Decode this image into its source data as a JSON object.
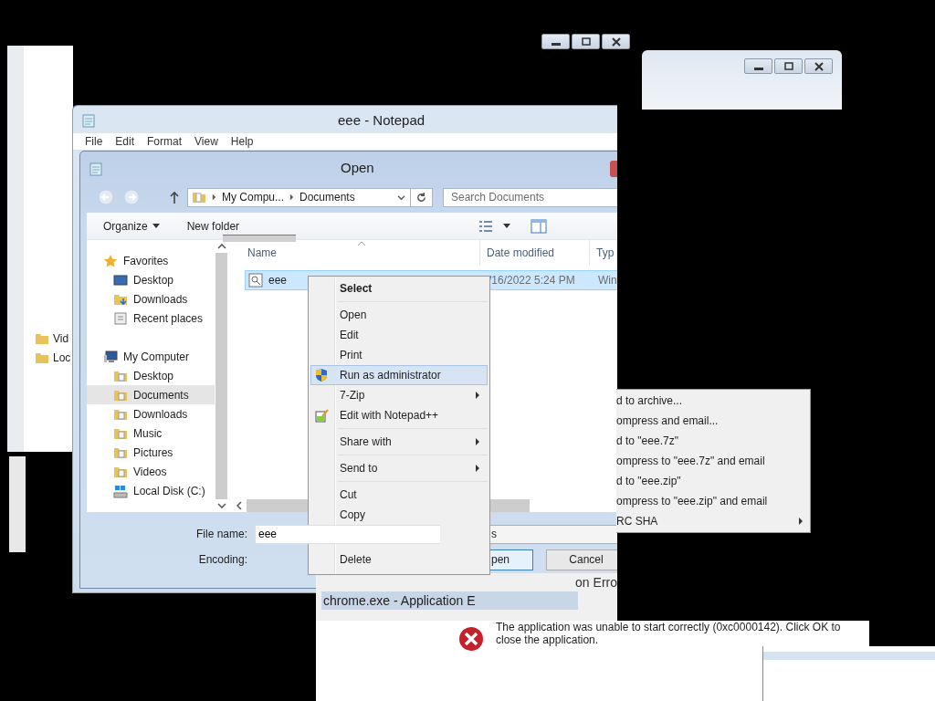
{
  "left_fragment": {
    "items": [
      {
        "label": "Vid"
      },
      {
        "label": "Loc"
      }
    ]
  },
  "notepad": {
    "title": "eee - Notepad",
    "menu": [
      "File",
      "Edit",
      "Format",
      "View",
      "Help"
    ]
  },
  "open_dialog": {
    "title": "Open",
    "breadcrumb": [
      "My Compu...",
      "Documents"
    ],
    "search": {
      "placeholder": "Search Documents"
    },
    "toolbar": {
      "organize": "Organize",
      "new_folder": "New folder"
    },
    "nav": [
      {
        "label": "Favorites",
        "kind": "favorites",
        "selected": false,
        "children": [
          {
            "label": "Desktop",
            "kind": "desktop",
            "selected": false
          },
          {
            "label": "Downloads",
            "kind": "downloads",
            "selected": false
          },
          {
            "label": "Recent places",
            "kind": "recent",
            "selected": false
          }
        ]
      },
      {
        "label": "My Computer",
        "kind": "computer",
        "selected": false,
        "children": [
          {
            "label": "Desktop",
            "kind": "folder",
            "selected": false
          },
          {
            "label": "Documents",
            "kind": "folder",
            "selected": true
          },
          {
            "label": "Downloads",
            "kind": "folder",
            "selected": false
          },
          {
            "label": "Music",
            "kind": "folder",
            "selected": false
          },
          {
            "label": "Pictures",
            "kind": "folder",
            "selected": false
          },
          {
            "label": "Videos",
            "kind": "folder",
            "selected": false
          },
          {
            "label": "Local Disk (C:)",
            "kind": "disk",
            "selected": false
          }
        ]
      }
    ],
    "columns": [
      "Name",
      "Date modified",
      "Typ"
    ],
    "rows": [
      {
        "name": "eee",
        "date": "/16/2022 5:24 PM",
        "type": "Win",
        "selected": true
      }
    ],
    "file_name": {
      "label": "File name:",
      "value": "eee"
    },
    "file_type": {
      "value": "s"
    },
    "encoding": {
      "label": "Encoding:"
    },
    "buttons": [
      {
        "label": "pen",
        "kind": "primary"
      },
      {
        "label": "Cancel",
        "kind": "normal"
      }
    ]
  },
  "context_menu": [
    {
      "kind": "header",
      "label": "Select",
      "selected": false
    },
    {
      "kind": "separator"
    },
    {
      "kind": "item",
      "label": "Open",
      "selected": false
    },
    {
      "kind": "item",
      "label": "Edit",
      "selected": false
    },
    {
      "kind": "item",
      "label": "Print",
      "selected": false
    },
    {
      "kind": "admin",
      "label": "Run as administrator",
      "selected": true
    },
    {
      "kind": "submenu",
      "label": "7-Zip",
      "selected": false
    },
    {
      "kind": "editor",
      "label": "Edit with Notepad++",
      "selected": false
    },
    {
      "kind": "separator"
    },
    {
      "kind": "submenu",
      "label": "Share with",
      "selected": false
    },
    {
      "kind": "separator"
    },
    {
      "kind": "submenu",
      "label": "Send to",
      "selected": false
    },
    {
      "kind": "separator"
    },
    {
      "kind": "item",
      "label": "Cut",
      "selected": false
    },
    {
      "kind": "item",
      "label": "Copy",
      "selected": false
    },
    {
      "kind": "gap"
    },
    {
      "kind": "item",
      "label": "Delete",
      "selected": false
    }
  ],
  "zip_submenu": [
    {
      "label": "d to archive...",
      "submenu": false
    },
    {
      "label": "ompress and email...",
      "submenu": false
    },
    {
      "label": "d to \"eee.7z\"",
      "submenu": false
    },
    {
      "label": "ompress to \"eee.7z\" and email",
      "submenu": false
    },
    {
      "label": "d to \"eee.zip\"",
      "submenu": false
    },
    {
      "label": "ompress to \"eee.zip\" and email",
      "submenu": false
    },
    {
      "label": "RC SHA",
      "submenu": true
    }
  ],
  "error_dialog": {
    "title_fragment": "on Erro",
    "title": "chrome.exe - Application E",
    "message": [
      "The application was unable to start correctly (0xc0000142). Click OK to",
      "close the application."
    ]
  }
}
